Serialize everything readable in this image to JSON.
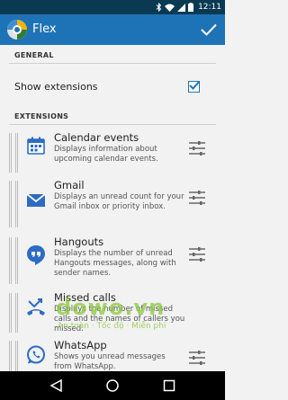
{
  "status_bar": {
    "time": "12:11"
  },
  "action_bar": {
    "title": "Flex",
    "confirm_icon": "check-icon"
  },
  "sections": {
    "general": "GENERAL",
    "extensions": "EXTENSIONS"
  },
  "general": {
    "show_extensions_label": "Show extensions",
    "show_extensions_checked": true
  },
  "extensions": [
    {
      "title": "Calendar events",
      "description": "Displays information about upcoming calendar events.",
      "icon": "calendar-icon"
    },
    {
      "title": "Gmail",
      "description": "Displays an unread count for your Gmail inbox or priority inbox.",
      "icon": "gmail-icon"
    },
    {
      "title": "Hangouts",
      "description": "Displays the number of unread Hangouts messages, along with sender names.",
      "icon": "hangouts-icon"
    },
    {
      "title": "Missed calls",
      "description": "Displays the number of missed calls and the names of callers you missed.",
      "icon": "missed-calls-icon"
    },
    {
      "title": "WhatsApp",
      "description": "Shows you unread messages from WhatsApp.",
      "icon": "whatsapp-icon"
    }
  ],
  "watermark": {
    "main": "dowo.vn",
    "sub": "An toàn · Tốc độ · Miễn phí"
  },
  "colors": {
    "status_bar": "#0a3a52",
    "action_bar": "#1e73b7",
    "accent": "#1e73b7",
    "background": "#f2f2f2"
  }
}
